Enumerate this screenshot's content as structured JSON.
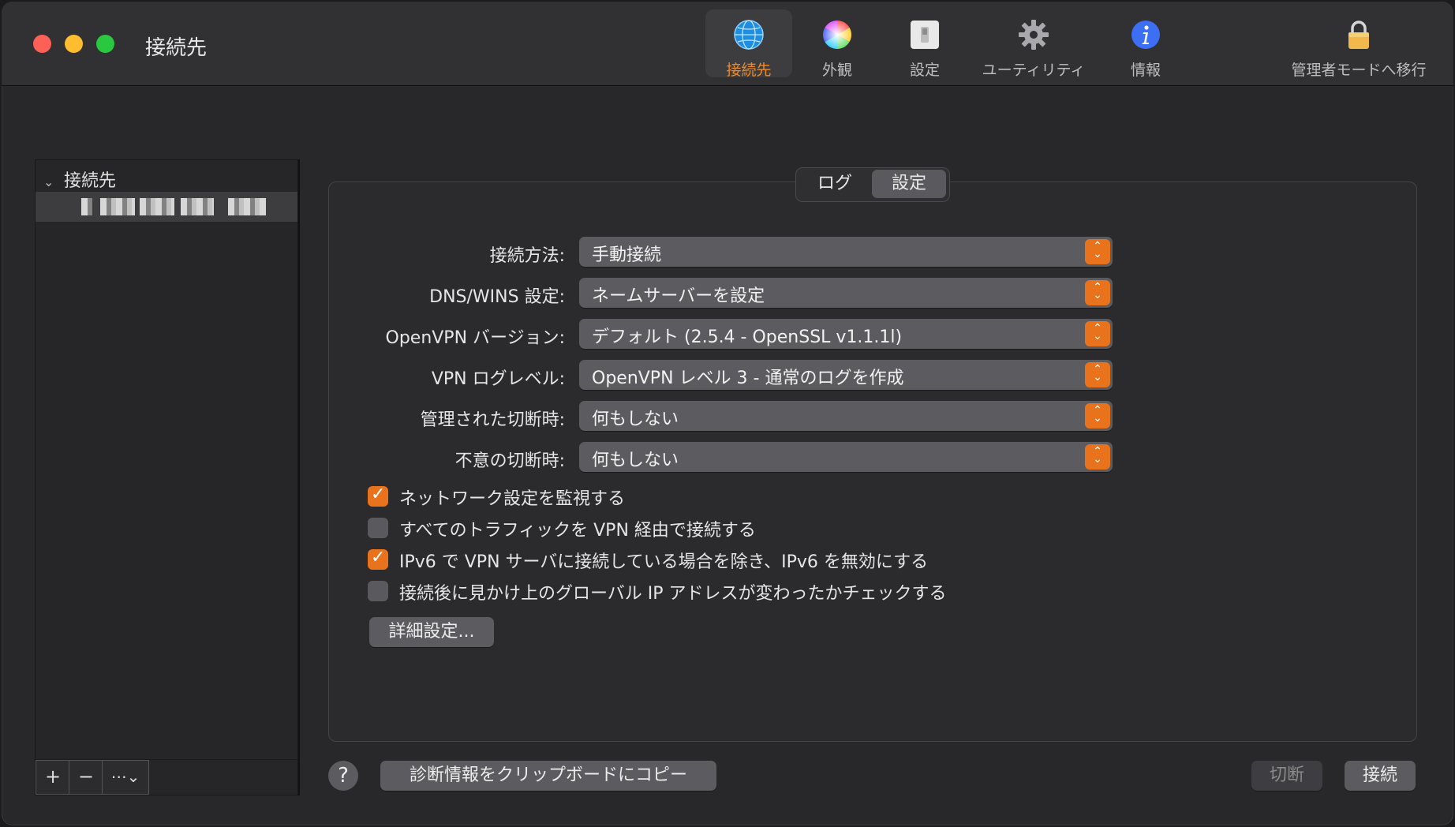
{
  "window": {
    "title": "接続先"
  },
  "toolbar": {
    "items": [
      {
        "label": "接続先",
        "icon": "globe-icon"
      },
      {
        "label": "外観",
        "icon": "color-wheel-icon"
      },
      {
        "label": "設定",
        "icon": "switch-icon"
      },
      {
        "label": "ユーティリティ",
        "icon": "gear-icon"
      },
      {
        "label": "情報",
        "icon": "info-icon"
      }
    ],
    "admin_label": "管理者モードへ移行",
    "accent_color": "#f08a24"
  },
  "sidebar": {
    "header": "接続先",
    "footer": {
      "add": "+",
      "remove": "−",
      "more": "⋯⌄"
    }
  },
  "tabs": {
    "log": "ログ",
    "settings": "設定"
  },
  "form": {
    "fields": [
      {
        "label": "接続方法:",
        "value": "手動接続"
      },
      {
        "label": "DNS/WINS 設定:",
        "value": "ネームサーバーを設定"
      },
      {
        "label": "OpenVPN バージョン:",
        "value": "デフォルト (2.5.4 - OpenSSL v1.1.1l)"
      },
      {
        "label": "VPN ログレベル:",
        "value": "OpenVPN レベル 3 - 通常のログを作成"
      },
      {
        "label": "管理された切断時:",
        "value": "何もしない"
      },
      {
        "label": "不意の切断時:",
        "value": "何もしない"
      }
    ],
    "checkboxes": [
      {
        "label": "ネットワーク設定を監視する",
        "checked": true
      },
      {
        "label": "すべてのトラフィックを VPN 経由で接続する",
        "checked": false
      },
      {
        "label": "IPv6 で VPN サーバに接続している場合を除き、IPv6 を無効にする",
        "checked": true
      },
      {
        "label": "接続後に見かけ上のグローバル IP アドレスが変わったかチェックする",
        "checked": false
      }
    ],
    "advanced_button": "詳細設定..."
  },
  "footer": {
    "help": "?",
    "copy_diagnostics": "診断情報をクリップボードにコピー",
    "disconnect": "切断",
    "connect": "接続"
  }
}
